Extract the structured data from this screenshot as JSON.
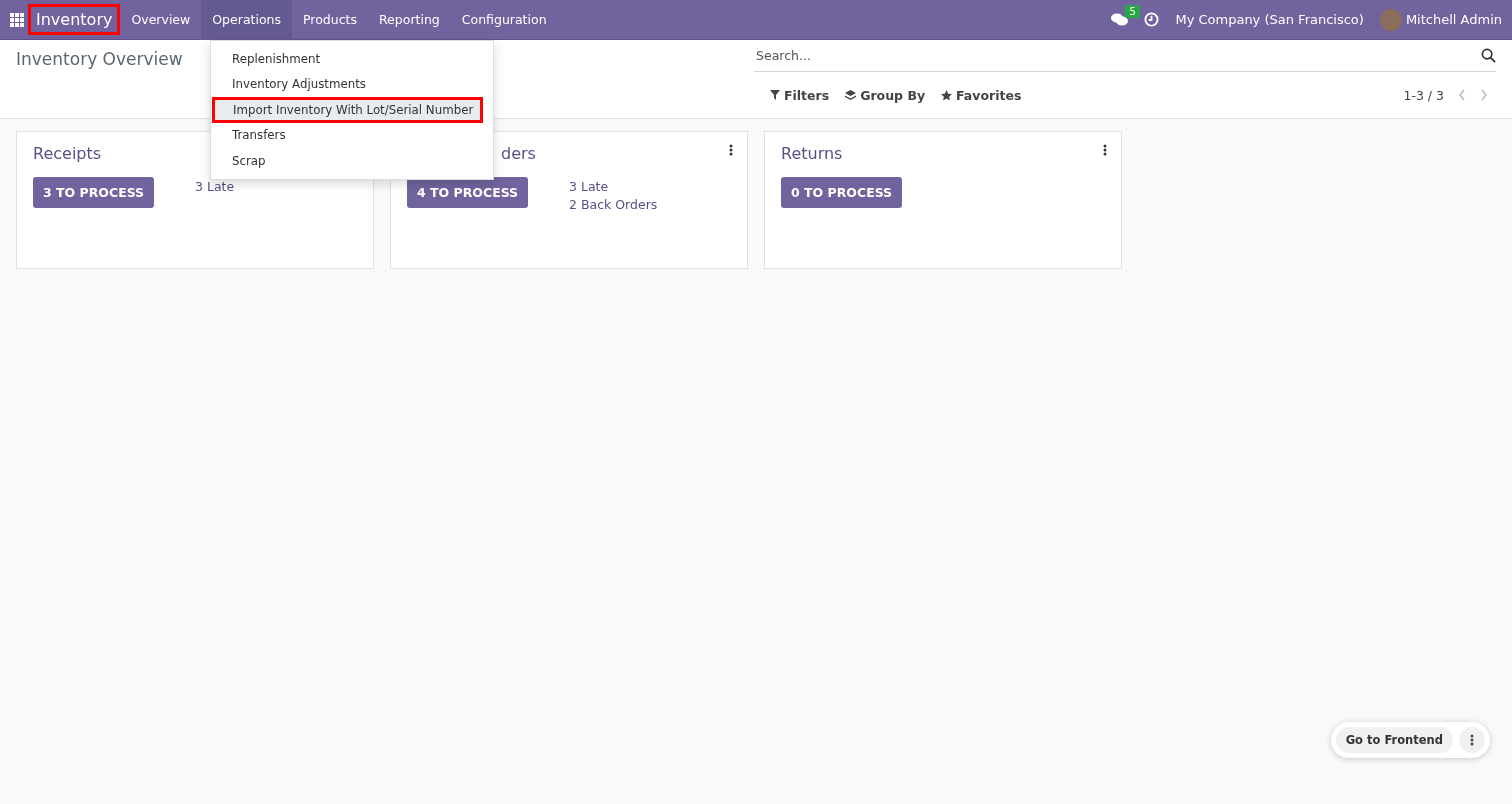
{
  "navbar": {
    "app_name": "Inventory",
    "app_name_highlighted": true,
    "menu": [
      {
        "label": "Overview",
        "selected": false
      },
      {
        "label": "Operations",
        "selected": true
      },
      {
        "label": "Products",
        "selected": false
      },
      {
        "label": "Reporting",
        "selected": false
      },
      {
        "label": "Configuration",
        "selected": false
      }
    ],
    "messages_badge": "5",
    "company": "My Company (San Francisco)",
    "user": "Mitchell Admin"
  },
  "dropdown": {
    "items": [
      {
        "label": "Replenishment",
        "highlighted": false
      },
      {
        "label": "Inventory Adjustments",
        "highlighted": false
      },
      {
        "label": "Import Inventory With Lot/Serial Number",
        "highlighted": true
      },
      {
        "label": "Transfers",
        "highlighted": false
      },
      {
        "label": "Scrap",
        "highlighted": false
      }
    ]
  },
  "control_panel": {
    "title": "Inventory Overview",
    "search": {
      "placeholder": "Search..."
    },
    "filters": [
      {
        "label": "Filters",
        "kind": "filter"
      },
      {
        "label": "Group By",
        "kind": "layers"
      },
      {
        "label": "Favorites",
        "kind": "star"
      }
    ],
    "pager": "1-3 / 3"
  },
  "cards": [
    {
      "title": "Receipts",
      "button": "3 TO PROCESS",
      "links": [
        "3 Late"
      ]
    },
    {
      "title": "ders",
      "title_cut_left": true,
      "button": "4 TO PROCESS",
      "links": [
        "3 Late",
        "2 Back Orders"
      ]
    },
    {
      "title": "Returns",
      "button": "0 TO PROCESS"
    }
  ],
  "frontend_button": "Go to Frontend"
}
